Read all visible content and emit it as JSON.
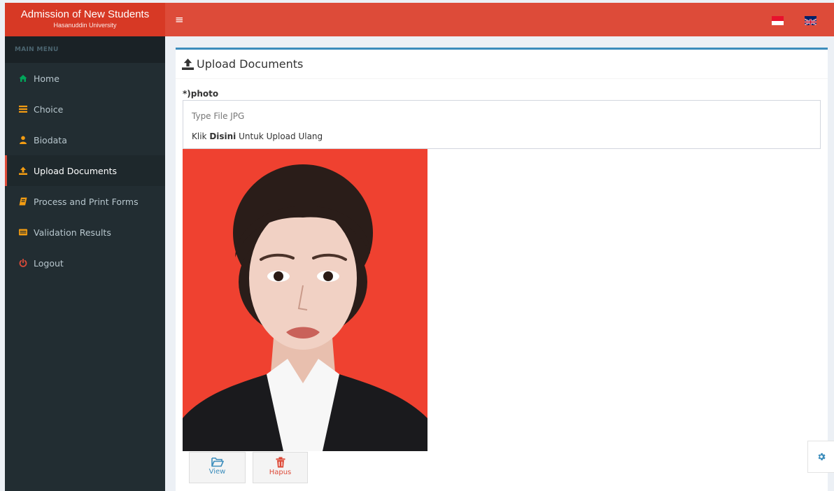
{
  "brand": {
    "title": "Admission of New Students",
    "subtitle": "Hasanuddin University"
  },
  "navbar": {
    "menu_toggle": "≡",
    "languages": [
      {
        "icon": "flag-indonesia-icon"
      },
      {
        "icon": "flag-uk-icon"
      }
    ]
  },
  "sidebar": {
    "header": "MAIN MENU",
    "items": [
      {
        "label": "Home",
        "icon": "home-icon",
        "color": "#00a65a"
      },
      {
        "label": "Choice",
        "icon": "list-icon",
        "color": "#f39c12"
      },
      {
        "label": "Biodata",
        "icon": "user-icon",
        "color": "#f39c12"
      },
      {
        "label": "Upload Documents",
        "icon": "upload-icon",
        "color": "#f39c12",
        "active": true
      },
      {
        "label": "Process and Print Forms",
        "icon": "book-icon",
        "color": "#f39c12"
      },
      {
        "label": "Validation Results",
        "icon": "id-card-icon",
        "color": "#f39c12"
      },
      {
        "label": "Logout",
        "icon": "power-icon",
        "color": "#dd4b39"
      }
    ]
  },
  "main": {
    "title": "Upload Documents",
    "photo_field": {
      "label": "*)photo",
      "type_hint": "Type File JPG",
      "reupload_prefix": "Klik ",
      "reupload_link": "Disini",
      "reupload_suffix": " Untuk Upload Ulang"
    },
    "buttons": {
      "view": "View",
      "delete": "Hapus"
    }
  },
  "colors": {
    "header": "#dd4b39",
    "logo": "#d73925",
    "sidebar": "#222d32",
    "box_border": "#3c8dbc",
    "photo_background": "#ef4130"
  }
}
